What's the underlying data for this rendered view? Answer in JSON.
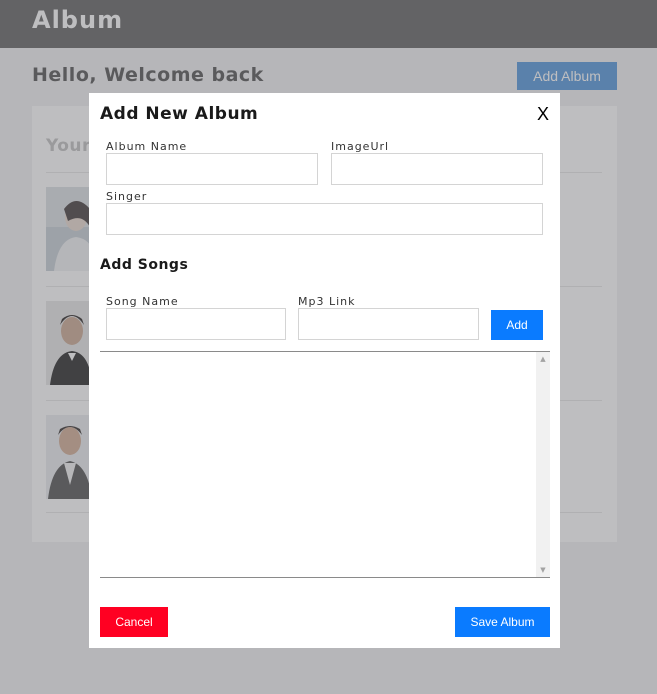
{
  "header": {
    "title": "Album"
  },
  "main": {
    "welcome": "Hello, Welcome back",
    "add_album_label": "Add Album",
    "albums_heading": "Your",
    "album_count": 3
  },
  "modal": {
    "title": "Add New Album",
    "close_label": "X",
    "fields": {
      "album_name": {
        "label": "Album Name",
        "value": "",
        "placeholder": ""
      },
      "image_url": {
        "label": "ImageUrl",
        "value": "",
        "placeholder": ""
      },
      "singer": {
        "label": "Singer",
        "value": "",
        "placeholder": ""
      }
    },
    "songs": {
      "heading": "Add Songs",
      "song_name_label": "Song Name",
      "mp3_link_label": "Mp3 Link",
      "add_label": "Add",
      "items": []
    },
    "cancel_label": "Cancel",
    "save_label": "Save Album"
  },
  "colors": {
    "header_bg": "#595959",
    "primary": "#0a7bff",
    "danger": "#ff0022",
    "add_album_bg": "#4a90d9"
  },
  "icons": {
    "scroll_up": "scroll-up-icon",
    "scroll_down": "scroll-down-icon"
  }
}
